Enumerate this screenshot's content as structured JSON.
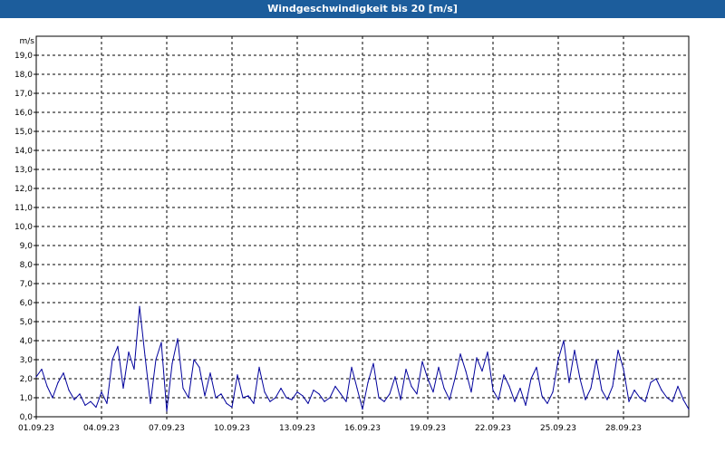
{
  "window": {
    "title": "Windgeschwindigkeit bis 20 [m/s]"
  },
  "colors": {
    "titlebar": "#1c5d9c",
    "series": "#00009c",
    "grid": "#000000",
    "background": "#ffffff"
  },
  "chart_data": {
    "type": "line",
    "title": "Windgeschwindigkeit bis 20 [m/s]",
    "ylabel": "m/s",
    "xlabel": "",
    "ylim": [
      0,
      20
    ],
    "yticks": [
      0,
      1,
      2,
      3,
      4,
      5,
      6,
      7,
      8,
      9,
      10,
      11,
      12,
      13,
      14,
      15,
      16,
      17,
      18,
      19
    ],
    "ytick_labels": [
      "0,0",
      "1,0",
      "2,0",
      "3,0",
      "4,0",
      "5,0",
      "6,0",
      "7,0",
      "8,0",
      "9,0",
      "10,0",
      "11,0",
      "12,0",
      "13,0",
      "14,0",
      "15,0",
      "16,0",
      "17,0",
      "18,0",
      "19,0"
    ],
    "xlim": [
      "2023-09-01",
      "2023-10-01"
    ],
    "xticks": [
      "2023-09-01",
      "2023-09-04",
      "2023-09-07",
      "2023-09-10",
      "2023-09-13",
      "2023-09-16",
      "2023-09-19",
      "2023-09-22",
      "2023-09-25",
      "2023-09-28"
    ],
    "xtick_labels": [
      "01.09.23",
      "04.09.23",
      "07.09.23",
      "10.09.23",
      "13.09.23",
      "16.09.23",
      "19.09.23",
      "22.09.23",
      "25.09.23",
      "28.09.23"
    ],
    "grid": true,
    "series": [
      {
        "x": [
          "2023-09-01T00:00",
          "2023-09-01T06:00",
          "2023-09-01T12:00",
          "2023-09-01T18:00",
          "2023-09-02T00:00",
          "2023-09-02T06:00",
          "2023-09-02T12:00",
          "2023-09-02T18:00",
          "2023-09-03T00:00",
          "2023-09-03T06:00",
          "2023-09-03T12:00",
          "2023-09-03T18:00",
          "2023-09-04T00:00",
          "2023-09-04T06:00",
          "2023-09-04T12:00",
          "2023-09-04T18:00",
          "2023-09-05T00:00",
          "2023-09-05T06:00",
          "2023-09-05T12:00",
          "2023-09-05T18:00",
          "2023-09-06T00:00",
          "2023-09-06T06:00",
          "2023-09-06T12:00",
          "2023-09-06T18:00",
          "2023-09-07T00:00",
          "2023-09-07T06:00",
          "2023-09-07T12:00",
          "2023-09-07T18:00",
          "2023-09-08T00:00",
          "2023-09-08T06:00",
          "2023-09-08T12:00",
          "2023-09-08T18:00",
          "2023-09-09T00:00",
          "2023-09-09T06:00",
          "2023-09-09T12:00",
          "2023-09-09T18:00",
          "2023-09-10T00:00",
          "2023-09-10T06:00",
          "2023-09-10T12:00",
          "2023-09-10T18:00",
          "2023-09-11T00:00",
          "2023-09-11T06:00",
          "2023-09-11T12:00",
          "2023-09-11T18:00",
          "2023-09-12T00:00",
          "2023-09-12T06:00",
          "2023-09-12T12:00",
          "2023-09-12T18:00",
          "2023-09-13T00:00",
          "2023-09-13T06:00",
          "2023-09-13T12:00",
          "2023-09-13T18:00",
          "2023-09-14T00:00",
          "2023-09-14T06:00",
          "2023-09-14T12:00",
          "2023-09-14T18:00",
          "2023-09-15T00:00",
          "2023-09-15T06:00",
          "2023-09-15T12:00",
          "2023-09-15T18:00",
          "2023-09-16T00:00",
          "2023-09-16T06:00",
          "2023-09-16T12:00",
          "2023-09-16T18:00",
          "2023-09-17T00:00",
          "2023-09-17T06:00",
          "2023-09-17T12:00",
          "2023-09-17T18:00",
          "2023-09-18T00:00",
          "2023-09-18T06:00",
          "2023-09-18T12:00",
          "2023-09-18T18:00",
          "2023-09-19T00:00",
          "2023-09-19T06:00",
          "2023-09-19T12:00",
          "2023-09-19T18:00",
          "2023-09-20T00:00",
          "2023-09-20T06:00",
          "2023-09-20T12:00",
          "2023-09-20T18:00",
          "2023-09-21T00:00",
          "2023-09-21T06:00",
          "2023-09-21T12:00",
          "2023-09-21T18:00",
          "2023-09-22T00:00",
          "2023-09-22T06:00",
          "2023-09-22T12:00",
          "2023-09-22T18:00",
          "2023-09-23T00:00",
          "2023-09-23T06:00",
          "2023-09-23T12:00",
          "2023-09-23T18:00",
          "2023-09-24T00:00",
          "2023-09-24T06:00",
          "2023-09-24T12:00",
          "2023-09-24T18:00",
          "2023-09-25T00:00",
          "2023-09-25T06:00",
          "2023-09-25T12:00",
          "2023-09-25T18:00",
          "2023-09-26T00:00",
          "2023-09-26T06:00",
          "2023-09-26T12:00",
          "2023-09-26T18:00",
          "2023-09-27T00:00",
          "2023-09-27T06:00",
          "2023-09-27T12:00",
          "2023-09-27T18:00",
          "2023-09-28T00:00",
          "2023-09-28T06:00",
          "2023-09-28T12:00",
          "2023-09-28T18:00",
          "2023-09-29T00:00",
          "2023-09-29T06:00",
          "2023-09-29T12:00",
          "2023-09-29T18:00",
          "2023-09-30T00:00",
          "2023-09-30T06:00",
          "2023-09-30T12:00",
          "2023-09-30T18:00",
          "2023-10-01T00:00"
        ],
        "values": [
          2.1,
          2.5,
          1.6,
          1.0,
          1.8,
          2.3,
          1.4,
          0.9,
          1.2,
          0.6,
          0.8,
          0.5,
          1.3,
          0.7,
          3.0,
          3.7,
          1.5,
          3.4,
          2.5,
          5.8,
          3.2,
          0.7,
          3.0,
          3.9,
          0.3,
          2.8,
          4.1,
          1.5,
          1.0,
          3.0,
          2.6,
          1.1,
          2.3,
          1.0,
          1.2,
          0.7,
          0.5,
          2.2,
          1.0,
          1.1,
          0.7,
          2.6,
          1.3,
          0.8,
          1.0,
          1.5,
          1.0,
          0.9,
          1.3,
          1.1,
          0.7,
          1.4,
          1.2,
          0.8,
          1.0,
          1.6,
          1.2,
          0.8,
          2.6,
          1.5,
          0.4,
          1.8,
          2.8,
          1.0,
          0.8,
          1.2,
          2.1,
          0.9,
          2.5,
          1.6,
          1.2,
          2.9,
          2.0,
          1.3,
          2.6,
          1.5,
          0.9,
          2.0,
          3.3,
          2.4,
          1.3,
          3.1,
          2.4,
          3.4,
          1.4,
          0.9,
          2.2,
          1.6,
          0.8,
          1.5,
          0.6,
          2.0,
          2.6,
          1.1,
          0.7,
          1.3,
          3.0,
          4.0,
          1.8,
          3.5,
          2.0,
          0.9,
          1.5,
          3.0,
          1.4,
          0.9,
          1.6,
          3.5,
          2.5,
          0.8,
          1.4,
          1.0,
          0.8,
          1.8,
          2.0,
          1.4,
          1.0,
          0.8,
          1.6,
          0.9,
          0.4
        ]
      }
    ]
  }
}
